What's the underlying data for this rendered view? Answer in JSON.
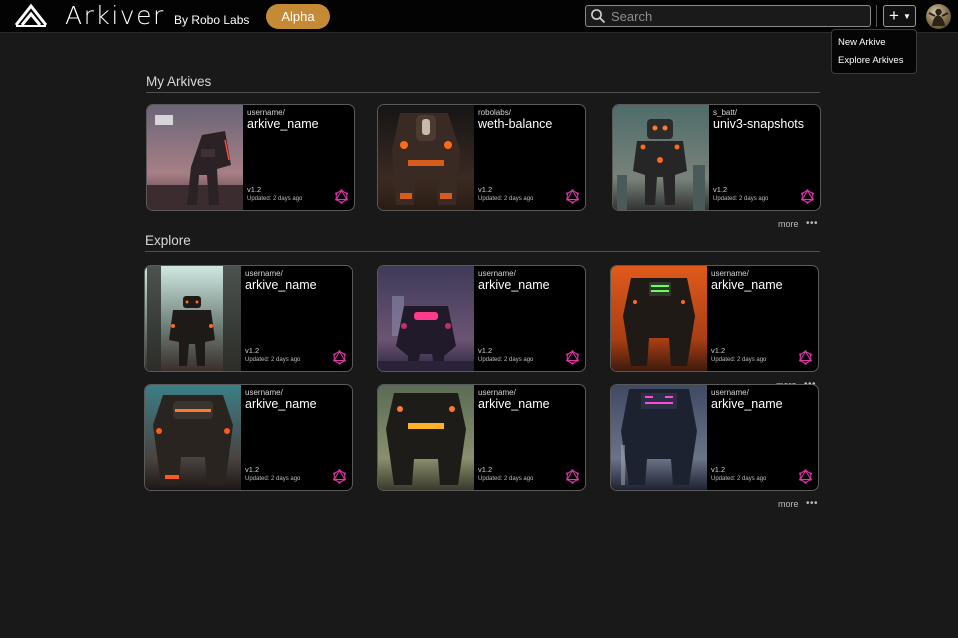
{
  "header": {
    "title": "Arkiver",
    "subtitle": "By Robo Labs",
    "badge": "Alpha",
    "search_placeholder": "Search",
    "new_button": "+",
    "avatar_icon": "user-avatar"
  },
  "menu": {
    "items": [
      "New Arkive",
      "Explore Arkives"
    ]
  },
  "sections": {
    "my_arkives": {
      "title": "My Arkives",
      "more": "more"
    },
    "explore": {
      "title": "Explore",
      "more": "more",
      "more_row2": "more",
      "more_bottom": "more"
    }
  },
  "my_arkives": [
    {
      "owner": "username/",
      "name": "arkive_name",
      "version": "v1.2",
      "updated": "Updated: 2 days ago"
    },
    {
      "owner": "robolabs/",
      "name": "weth-balance",
      "version": "v1.2",
      "updated": "Updated: 2 days ago"
    },
    {
      "owner": "s_batt/",
      "name": "univ3-snapshots",
      "version": "v1.2",
      "updated": "Updated: 2 days ago"
    }
  ],
  "explore": [
    {
      "owner": "username/",
      "name": "arkive_name",
      "version": "v1.2",
      "updated": "Updated: 2 days ago"
    },
    {
      "owner": "username/",
      "name": "arkive_name",
      "version": "v1.2",
      "updated": "Updated: 2 days ago"
    },
    {
      "owner": "username/",
      "name": "arkive_name",
      "version": "v1.2",
      "updated": "Updated: 2 days ago"
    },
    {
      "owner": "username/",
      "name": "arkive_name",
      "version": "v1.2",
      "updated": "Updated: 2 days ago"
    },
    {
      "owner": "username/",
      "name": "arkive_name",
      "version": "v1.2",
      "updated": "Updated: 2 days ago"
    },
    {
      "owner": "username/",
      "name": "arkive_name",
      "version": "v1.2",
      "updated": "Updated: 2 days ago"
    }
  ],
  "colors": {
    "accent": "#c48a35",
    "graphql_badge": "#e535ab",
    "background": "#191919",
    "navbar": "#030303"
  },
  "icons": {
    "logo": "arkiver-logo-icon",
    "search": "search-icon",
    "badge": "graphql-icon",
    "more": "more-dots-icon"
  }
}
